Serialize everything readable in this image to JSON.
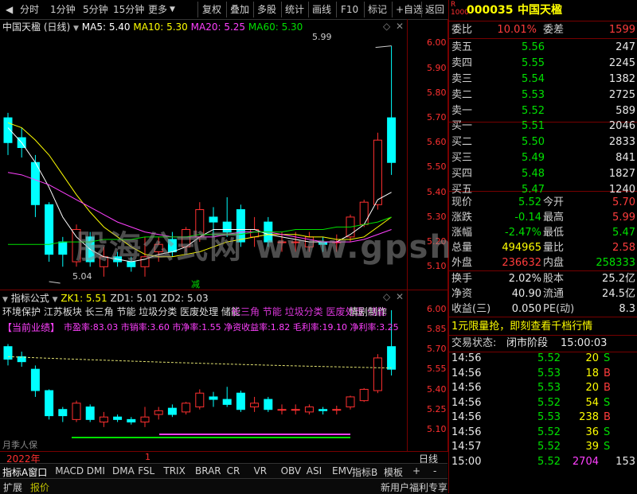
{
  "toolbar": {
    "left_items": [
      "分时",
      "1分钟",
      "5分钟",
      "15分钟",
      "更多"
    ],
    "right_items": [
      "复权",
      "叠加",
      "多股",
      "统计",
      "画线",
      "F10",
      "标记",
      "+自选",
      "返回"
    ]
  },
  "main_chart": {
    "title": "中国天楹 (日线)",
    "ma5": "MA5: 5.40",
    "ma10": "MA10: 5.30",
    "ma20": "MA20: 5.25",
    "ma60": "MA60: 5.30",
    "high_label": "5.99",
    "low_label": "5.04",
    "reduce_label": "减",
    "y_ticks": [
      "6.00",
      "5.90",
      "5.80",
      "5.70",
      "5.60",
      "5.50",
      "5.40",
      "5.30",
      "5.20",
      "5.10"
    ],
    "colors": {
      "up": "#ff3030",
      "down": "#00ffff",
      "ma5": "#ffffff",
      "ma10": "#ffff00",
      "ma20": "#ff40ff",
      "ma60": "#00e000"
    }
  },
  "chart_data": {
    "type": "candlestick",
    "ylim": [
      5.04,
      6.04
    ],
    "candles": [
      {
        "o": 5.7,
        "c": 5.6,
        "h": 5.72,
        "l": 5.55
      },
      {
        "o": 5.62,
        "c": 5.58,
        "h": 5.66,
        "l": 5.54
      },
      {
        "o": 5.52,
        "c": 5.35,
        "h": 5.55,
        "l": 5.3
      },
      {
        "o": 5.35,
        "c": 5.15,
        "h": 5.36,
        "l": 5.12
      },
      {
        "o": 5.2,
        "c": 5.15,
        "h": 5.22,
        "l": 5.1
      },
      {
        "o": 5.12,
        "c": 5.25,
        "h": 5.27,
        "l": 5.1
      },
      {
        "o": 5.22,
        "c": 5.12,
        "h": 5.24,
        "l": 5.1
      },
      {
        "o": 5.1,
        "c": 5.14,
        "h": 5.18,
        "l": 5.06
      },
      {
        "o": 5.14,
        "c": 5.12,
        "h": 5.16,
        "l": 5.1
      },
      {
        "o": 5.12,
        "c": 5.1,
        "h": 5.14,
        "l": 5.08
      },
      {
        "o": 5.1,
        "c": 5.14,
        "h": 5.22,
        "l": 5.06
      },
      {
        "o": 5.16,
        "c": 5.19,
        "h": 5.22,
        "l": 5.12
      },
      {
        "o": 5.21,
        "c": 5.16,
        "h": 5.24,
        "l": 5.14
      },
      {
        "o": 5.18,
        "c": 5.25,
        "h": 5.26,
        "l": 5.16
      },
      {
        "o": 5.22,
        "c": 5.33,
        "h": 5.36,
        "l": 5.2
      },
      {
        "o": 5.3,
        "c": 5.28,
        "h": 5.34,
        "l": 5.22
      },
      {
        "o": 5.28,
        "c": 5.24,
        "h": 5.38,
        "l": 5.22
      },
      {
        "o": 5.33,
        "c": 5.2,
        "h": 5.35,
        "l": 5.18
      },
      {
        "o": 5.22,
        "c": 5.25,
        "h": 5.3,
        "l": 5.18
      },
      {
        "o": 5.28,
        "c": 5.2,
        "h": 5.3,
        "l": 5.18
      },
      {
        "o": 5.2,
        "c": 5.2,
        "h": 5.24,
        "l": 5.16
      },
      {
        "o": 5.2,
        "c": 5.2,
        "h": 5.24,
        "l": 5.16
      },
      {
        "o": 5.18,
        "c": 5.22,
        "h": 5.24,
        "l": 5.16
      },
      {
        "o": 5.2,
        "c": 5.19,
        "h": 5.22,
        "l": 5.16
      },
      {
        "o": 5.2,
        "c": 5.2,
        "h": 5.23,
        "l": 5.16
      },
      {
        "o": 5.22,
        "c": 5.3,
        "h": 5.31,
        "l": 5.2
      },
      {
        "o": 5.27,
        "c": 5.36,
        "h": 5.37,
        "l": 5.26
      },
      {
        "o": 5.35,
        "c": 5.61,
        "h": 5.64,
        "l": 5.33
      },
      {
        "o": 5.7,
        "c": 5.52,
        "h": 5.99,
        "l": 5.47
      }
    ],
    "ma5": [
      5.66,
      5.6,
      5.52,
      5.42,
      5.3,
      5.22,
      5.17,
      5.14,
      5.13,
      5.12,
      5.13,
      5.15,
      5.16,
      5.18,
      5.22,
      5.25,
      5.25,
      5.25,
      5.25,
      5.23,
      5.22,
      5.21,
      5.2,
      5.2,
      5.2,
      5.23,
      5.27,
      5.37,
      5.4
    ],
    "ma10": [
      5.68,
      5.66,
      5.61,
      5.55,
      5.47,
      5.39,
      5.32,
      5.26,
      5.22,
      5.18,
      5.15,
      5.14,
      5.14,
      5.15,
      5.16,
      5.18,
      5.2,
      5.21,
      5.22,
      5.23,
      5.23,
      5.23,
      5.22,
      5.22,
      5.21,
      5.21,
      5.22,
      5.26,
      5.3
    ],
    "ma20": [
      5.48,
      5.47,
      5.45,
      5.43,
      5.4,
      5.37,
      5.34,
      5.31,
      5.28,
      5.26,
      5.24,
      5.23,
      5.22,
      5.22,
      5.22,
      5.22,
      5.23,
      5.24,
      5.24,
      5.24,
      5.23,
      5.22,
      5.21,
      5.2,
      5.2,
      5.2,
      5.21,
      5.23,
      5.25
    ],
    "ma60": [
      5.19,
      5.19,
      5.19,
      5.19,
      5.2,
      5.2,
      5.2,
      5.21,
      5.21,
      5.21,
      5.22,
      5.22,
      5.22,
      5.22,
      5.23,
      5.23,
      5.23,
      5.23,
      5.24,
      5.24,
      5.24,
      5.25,
      5.25,
      5.25,
      5.26,
      5.26,
      5.27,
      5.28,
      5.3
    ]
  },
  "indicator_chart": {
    "title": "指标公式",
    "zk1": "ZK1: 5.51",
    "zd1": "ZD1: 5.01",
    "zd2": "ZD2: 5.03",
    "text_line1": "环境保护 江苏板块 长三角 节能 垃圾分类 医废处理 储能",
    "text_line1_ghost": "长三角 节能 垃圾分类 医废处理 储能",
    "text_line1_right": "情剧制作",
    "text_line2": "市盈率:83.03 市销率:3.60 市净率:1.55 净资收益率:1.82 毛利率:19.10 净利率:3.25",
    "text_line3_prefix": "【当前业绩】",
    "y_ticks": [
      "6.00",
      "5.85",
      "5.70",
      "5.55",
      "5.40",
      "5.25",
      "5.10"
    ],
    "bottom_left_text": "月季人保"
  },
  "watermark": "股海公式网 www.gpshiw.com",
  "time_axis": {
    "year_label": "2022年",
    "mid_tick": "1",
    "right_label": "日线"
  },
  "bottom_tabs": [
    "指标A",
    "窗口",
    "MACD",
    "DMI",
    "DMA",
    "FSL",
    "TRIX",
    "BRAR",
    "CR",
    "VR",
    "OBV",
    "ASI",
    "EMV"
  ],
  "bottom_tabs_right": [
    "指标B",
    "模板",
    "+",
    "-"
  ],
  "status_bar": {
    "left_items": [
      "扩展",
      "↑",
      "↓",
      "↓",
      "↓",
      "↓",
      "↓",
      "↓",
      "↓",
      "↓",
      "↓",
      "↓",
      "↓",
      "↓",
      "↓",
      "↓",
      "↓",
      "↓",
      "↓",
      "↓",
      "↓",
      "↓",
      "↓",
      "↓",
      "↓"
    ],
    "right_text": "新用户福利专享"
  },
  "quote": {
    "code_badge": "R 1000",
    "code": "000035",
    "name": "中国天楹",
    "weibi_label": "委比",
    "weibi": "10.01%",
    "weicha_label": "委差",
    "weicha": "1599",
    "asks": [
      {
        "label": "卖五",
        "price": "5.56",
        "vol": "247"
      },
      {
        "label": "卖四",
        "price": "5.55",
        "vol": "2245"
      },
      {
        "label": "卖三",
        "price": "5.54",
        "vol": "1382"
      },
      {
        "label": "卖二",
        "price": "5.53",
        "vol": "2725"
      },
      {
        "label": "卖一",
        "price": "5.52",
        "vol": "589"
      }
    ],
    "bids": [
      {
        "label": "买一",
        "price": "5.51",
        "vol": "2046"
      },
      {
        "label": "买二",
        "price": "5.50",
        "vol": "2833"
      },
      {
        "label": "买三",
        "price": "5.49",
        "vol": "841"
      },
      {
        "label": "买四",
        "price": "5.48",
        "vol": "1827"
      },
      {
        "label": "买五",
        "price": "5.47",
        "vol": "1240"
      }
    ],
    "stats": [
      {
        "l1": "现价",
        "v1": "5.52",
        "c1": "green",
        "l2": "今开",
        "v2": "5.70",
        "c2": "red"
      },
      {
        "l1": "涨跌",
        "v1": "-0.14",
        "c1": "green",
        "l2": "最高",
        "v2": "5.99",
        "c2": "red"
      },
      {
        "l1": "涨幅",
        "v1": "-2.47%",
        "c1": "green",
        "l2": "最低",
        "v2": "5.47",
        "c2": "green"
      },
      {
        "l1": "总量",
        "v1": "494965",
        "c1": "yellow",
        "l2": "量比",
        "v2": "2.58",
        "c2": "red"
      },
      {
        "l1": "外盘",
        "v1": "236632",
        "c1": "red",
        "l2": "内盘",
        "v2": "258333",
        "c2": "green"
      }
    ],
    "stats2": [
      {
        "l1": "换手",
        "v1": "2.02%",
        "l2": "股本",
        "v2": "25.2亿"
      },
      {
        "l1": "净资",
        "v1": "40.90",
        "l2": "流通",
        "v2": "24.5亿"
      },
      {
        "l1": "收益(三)",
        "v1": "0.050",
        "l2": "PE(动)",
        "v2": "8.3"
      }
    ],
    "promo": "1元限量抢，即刻查看千档行情",
    "trade_status_label": "交易状态:",
    "trade_status": "闭市阶段",
    "trade_time": "15:00:03",
    "ticks": [
      {
        "t": "14:56",
        "p": "5.52",
        "v": "20",
        "d": "S"
      },
      {
        "t": "14:56",
        "p": "5.53",
        "v": "18",
        "d": "B"
      },
      {
        "t": "14:56",
        "p": "5.53",
        "v": "20",
        "d": "B"
      },
      {
        "t": "14:56",
        "p": "5.52",
        "v": "54",
        "d": "S"
      },
      {
        "t": "14:56",
        "p": "5.53",
        "v": "238",
        "d": "B"
      },
      {
        "t": "14:56",
        "p": "5.52",
        "v": "36",
        "d": "S"
      },
      {
        "t": "14:57",
        "p": "5.52",
        "v": "39",
        "d": "S"
      },
      {
        "t": "15:00",
        "p": "5.52",
        "v": "2704",
        "d": ""
      }
    ],
    "last_tick_extra": "153"
  }
}
